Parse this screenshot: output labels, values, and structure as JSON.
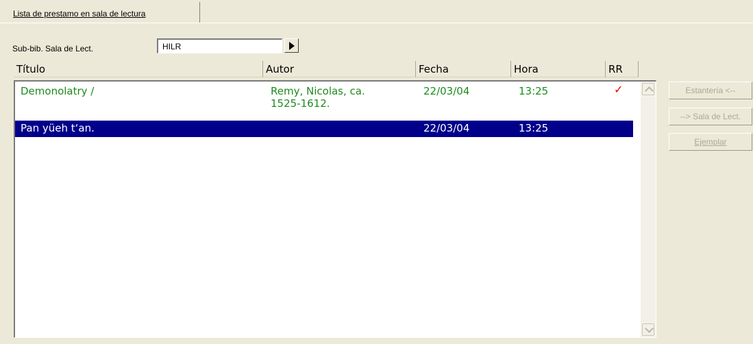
{
  "tab": {
    "label": "Lista de prestamo en sala de lectura"
  },
  "subbib": {
    "label": "Sub-bib. Sala de Lect.",
    "value": "HILR"
  },
  "table": {
    "columns": [
      "Título",
      "Autor",
      "Fecha",
      "Hora",
      "RR"
    ],
    "rows": [
      {
        "titulo": "Demonolatry /",
        "autor_line1": "Remy, Nicolas, ca.",
        "autor_line2": "1525-1612.",
        "fecha": "22/03/04",
        "hora": "13:25",
        "rr": "✓"
      },
      {
        "titulo": "Pan yüeh t‘an.",
        "autor_line1": "",
        "autor_line2": "",
        "fecha": "22/03/04",
        "hora": "13:25",
        "rr": ""
      }
    ]
  },
  "buttons": {
    "estanteria": "Estantería <--",
    "sala": "--> Sala de Lect.",
    "ejemplar": "Ejemplar"
  }
}
